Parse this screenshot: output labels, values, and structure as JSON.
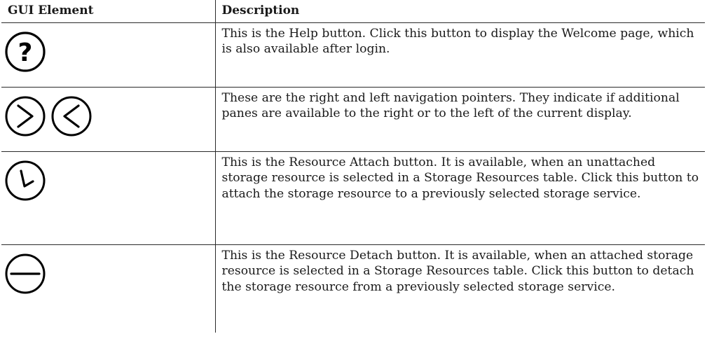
{
  "table": {
    "headers": {
      "gui_element": "GUI Element",
      "description": "Description"
    },
    "rows": [
      {
        "icons": [
          "help-icon"
        ],
        "description": "This is the Help button. Click this button to display the Welcome page, which is also available after login."
      },
      {
        "icons": [
          "chevron-right-circle-icon",
          "chevron-left-circle-icon"
        ],
        "description": "These are the right and left navigation pointers. They indicate if additional panes are available to the right or to the left of the current display."
      },
      {
        "icons": [
          "resource-attach-icon"
        ],
        "description": "This is the Resource Attach button. It is available, when an unattached storage resource is selected in a Storage Resources table. Click this button to attach the storage resource to a previously selected storage service."
      },
      {
        "icons": [
          "resource-detach-icon"
        ],
        "description": "This is the Resource Detach button. It is available, when an attached storage resource is selected in a Storage Resources table. Click this button to detach the storage resource from a previously selected storage service."
      }
    ]
  },
  "colors": {
    "border": "#2a2a2a",
    "text": "#1a1a1a",
    "icon_stroke": "#000000"
  }
}
